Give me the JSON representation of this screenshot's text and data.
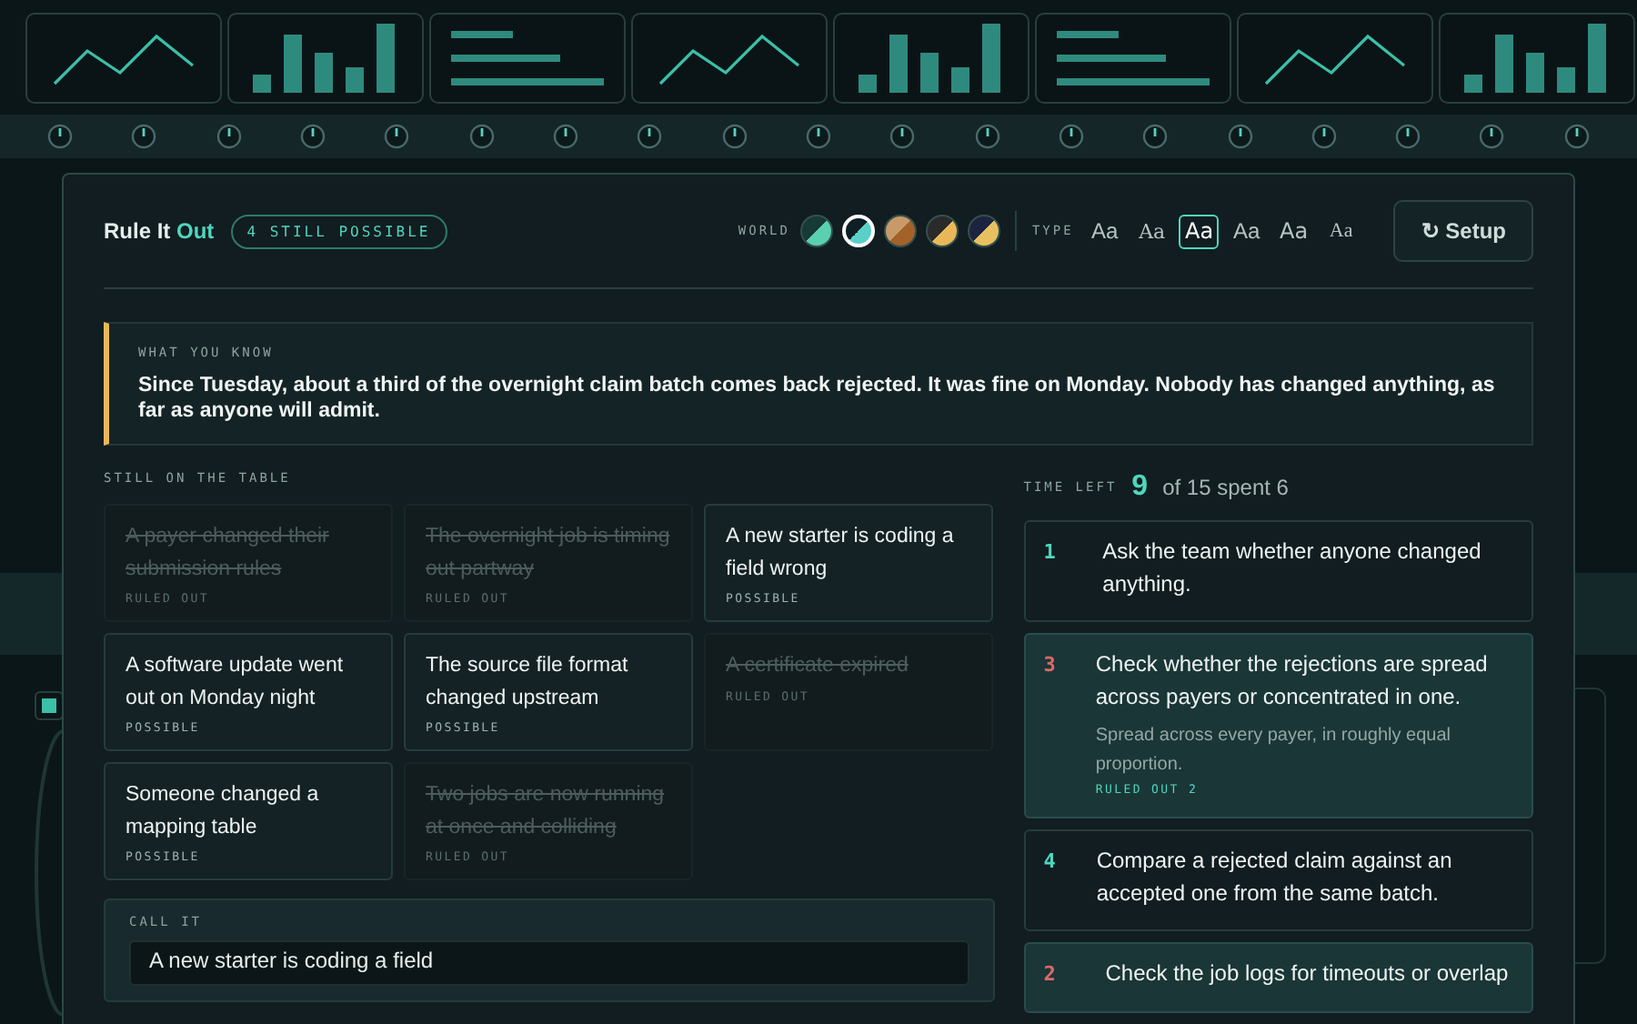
{
  "backdrop": {
    "tiles": [
      {
        "kind": "line"
      },
      {
        "kind": "bars"
      },
      {
        "kind": "text"
      },
      {
        "kind": "line"
      },
      {
        "kind": "bars"
      },
      {
        "kind": "text"
      },
      {
        "kind": "line"
      },
      {
        "kind": "bars"
      }
    ]
  },
  "header": {
    "title": "Rule It",
    "title_accent": "Out",
    "badge": "4 STILL POSSIBLE",
    "world_label": "WORLD",
    "worlds": [
      {
        "selected": false,
        "kind": "mint"
      },
      {
        "selected": true,
        "kind": "teal"
      },
      {
        "selected": false,
        "kind": "copper"
      },
      {
        "selected": false,
        "kind": "amber"
      },
      {
        "selected": false,
        "kind": "navy"
      }
    ],
    "type_label": "TYPE",
    "type_options": [
      {
        "label": "Aa",
        "kind": "grotesk",
        "selected": false
      },
      {
        "label": "Aa",
        "kind": "serif",
        "selected": false
      },
      {
        "label": "Aa",
        "kind": "sans",
        "selected": true
      },
      {
        "label": "Aa",
        "kind": "rounded",
        "selected": false
      },
      {
        "label": "Aa",
        "kind": "humanist",
        "selected": false
      },
      {
        "label": "Aa",
        "kind": "bookish",
        "selected": false
      }
    ],
    "setup_button": "↻ Setup"
  },
  "briefing": {
    "label": "WHAT YOU KNOW",
    "text": "Since Tuesday, about a third of the overnight claim batch comes back rejected. It was fine on Monday. Nobody has changed anything, as far as anyone will admit."
  },
  "hypotheses": {
    "label": "STILL ON THE TABLE",
    "items": [
      {
        "text": "A payer changed their submission rules",
        "status": "RULED OUT",
        "ruled_out": true
      },
      {
        "text": "The overnight job is timing out partway",
        "status": "RULED OUT",
        "ruled_out": true
      },
      {
        "text": "A new starter is coding a field wrong",
        "status": "POSSIBLE",
        "ruled_out": false
      },
      {
        "text": "A software update went out on Monday night",
        "status": "POSSIBLE",
        "ruled_out": false
      },
      {
        "text": "The source file format changed upstream",
        "status": "POSSIBLE",
        "ruled_out": false
      },
      {
        "text": "A certificate expired",
        "status": "RULED OUT",
        "ruled_out": true
      },
      {
        "text": "Someone changed a mapping table",
        "status": "POSSIBLE",
        "ruled_out": false
      },
      {
        "text": "Two jobs are now running at once and colliding",
        "status": "RULED OUT",
        "ruled_out": true
      }
    ]
  },
  "call_it": {
    "label": "CALL IT",
    "value": "A new starter is coding a field"
  },
  "time": {
    "label": "TIME LEFT",
    "value": "9",
    "detail": "of 15 spent 6"
  },
  "steps": [
    {
      "number": "1",
      "text": "Ask the team whether anyone changed anything.",
      "done": false
    },
    {
      "number": "3",
      "text": "Check whether the rejections are spread across payers or concentrated in one.",
      "done": true,
      "result": "Spread across every payer, in roughly equal proportion.",
      "tag": "RULED OUT 2"
    },
    {
      "number": "4",
      "text": "Compare a rejected claim against an accepted one from the same batch.",
      "done": false
    },
    {
      "number": "2",
      "text": "Check the job logs for timeouts or overlap",
      "done": true
    }
  ]
}
